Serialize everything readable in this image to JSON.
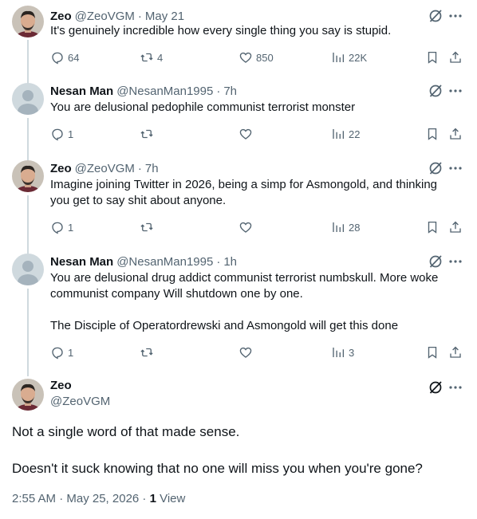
{
  "replies": [
    {
      "name": "Zeo",
      "handle": "@ZeoVGM",
      "time": "May 21",
      "avatar": "zeo-avatar",
      "text": [
        "It's genuinely incredible how every single thing you say is stupid."
      ],
      "stats": {
        "replies": "64",
        "retweets": "4",
        "likes": "850",
        "views": "22K"
      }
    },
    {
      "name": "Nesan Man",
      "handle": "@NesanMan1995",
      "time": "7h",
      "avatar": "default-avatar",
      "text": [
        "You are delusional pedophile communist terrorist monster"
      ],
      "stats": {
        "replies": "1",
        "retweets": "",
        "likes": "",
        "views": "22"
      }
    },
    {
      "name": "Zeo",
      "handle": "@ZeoVGM",
      "time": "7h",
      "avatar": "zeo-avatar",
      "text": [
        "Imagine joining Twitter in 2026, being a simp for Asmongold, and thinking you get to say shit about anyone."
      ],
      "stats": {
        "replies": "1",
        "retweets": "",
        "likes": "",
        "views": "28"
      }
    },
    {
      "name": "Nesan Man",
      "handle": "@NesanMan1995",
      "time": "1h",
      "avatar": "default-avatar",
      "text": [
        "You are delusional drug addict communist terrorist numbskull.  More woke communist company Will shutdown one by one.",
        "The Disciple of Operatordrewski and Asmongold will get this done"
      ],
      "stats": {
        "replies": "1",
        "retweets": "",
        "likes": "",
        "views": "3"
      }
    }
  ],
  "main": {
    "name": "Zeo",
    "handle": "@ZeoVGM",
    "text": [
      "Not a single word of that made sense.",
      "Doesn't it suck knowing that no one will miss you when you're gone?"
    ],
    "timestamp": "2:55 AM · May 25, 2026 · ",
    "views_count": "1",
    "views_label": " View"
  },
  "separator": "·",
  "colors": {
    "text": "#0f1419",
    "secondary": "#536471",
    "thread_line": "#cfd9de"
  }
}
